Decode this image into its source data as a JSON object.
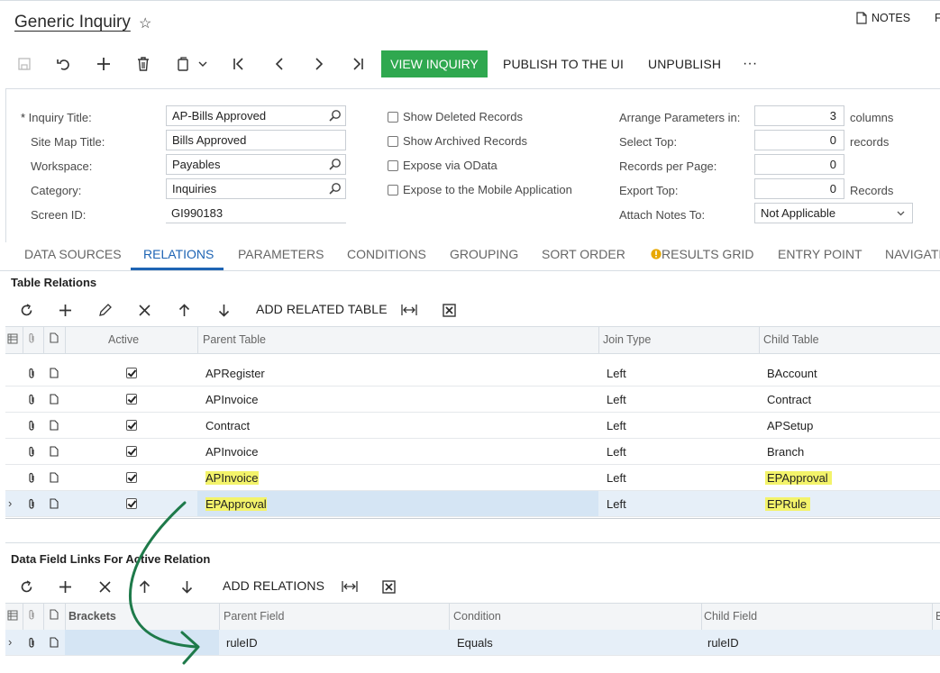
{
  "header": {
    "title": "Generic Inquiry",
    "notes_label": "NOTES",
    "files_label_cut": "F"
  },
  "toolbar": {
    "view_inquiry": "VIEW INQUIRY",
    "publish": "PUBLISH TO THE UI",
    "unpublish": "UNPUBLISH",
    "more": "···"
  },
  "form": {
    "inquiry_title_label": "Inquiry Title:",
    "inquiry_title_value": "AP-Bills Approved",
    "site_map_title_label": "Site Map Title:",
    "site_map_title_value": "Bills Approved",
    "workspace_label": "Workspace:",
    "workspace_value": "Payables",
    "category_label": "Category:",
    "category_value": "Inquiries",
    "screen_id_label": "Screen ID:",
    "screen_id_value": "GI990183",
    "show_deleted": "Show Deleted Records",
    "show_archived": "Show Archived Records",
    "expose_odata": "Expose via OData",
    "expose_mobile": "Expose to the Mobile Application",
    "arrange_label": "Arrange Parameters in:",
    "arrange_value": "3",
    "arrange_unit": "columns",
    "select_top_label": "Select Top:",
    "select_top_value": "0",
    "select_top_unit": "records",
    "records_per_page_label": "Records per Page:",
    "records_per_page_value": "0",
    "export_top_label": "Export Top:",
    "export_top_value": "0",
    "export_top_unit": "Records",
    "attach_notes_label": "Attach Notes To:",
    "attach_notes_value": "Not Applicable"
  },
  "tabs": [
    "DATA SOURCES",
    "RELATIONS",
    "PARAMETERS",
    "CONDITIONS",
    "GROUPING",
    "SORT ORDER",
    "RESULTS GRID",
    "ENTRY POINT",
    "NAVIGATIO"
  ],
  "table_relations": {
    "title": "Table Relations",
    "add_label": "ADD RELATED TABLE",
    "columns": {
      "active": "Active",
      "parent": "Parent Table",
      "join": "Join Type",
      "child": "Child Table"
    },
    "rows": [
      {
        "parent": "APRegister",
        "join": "Left",
        "child": "BAccount"
      },
      {
        "parent": "APInvoice",
        "join": "Left",
        "child": "Contract"
      },
      {
        "parent": "Contract",
        "join": "Left",
        "child": "APSetup"
      },
      {
        "parent": "APInvoice",
        "join": "Left",
        "child": "Branch"
      },
      {
        "parent": "APInvoice",
        "join": "Left",
        "child": "EPApproval"
      },
      {
        "parent": "EPApproval",
        "join": "Left",
        "child": "EPRule"
      }
    ]
  },
  "data_field_links": {
    "title": "Data Field Links For Active Relation",
    "add_label": "ADD RELATIONS",
    "columns": {
      "brackets": "Brackets",
      "parent_field": "Parent Field",
      "condition": "Condition",
      "child_field": "Child Field",
      "cut": "B"
    },
    "row": {
      "parent_field": "ruleID",
      "condition": "Equals",
      "child_field": "ruleID"
    }
  },
  "colors": {
    "accent": "#1e64b4",
    "green_button": "#2fa84f",
    "highlight": "#f3f36a",
    "annotation_arrow": "#1e7a4a"
  }
}
